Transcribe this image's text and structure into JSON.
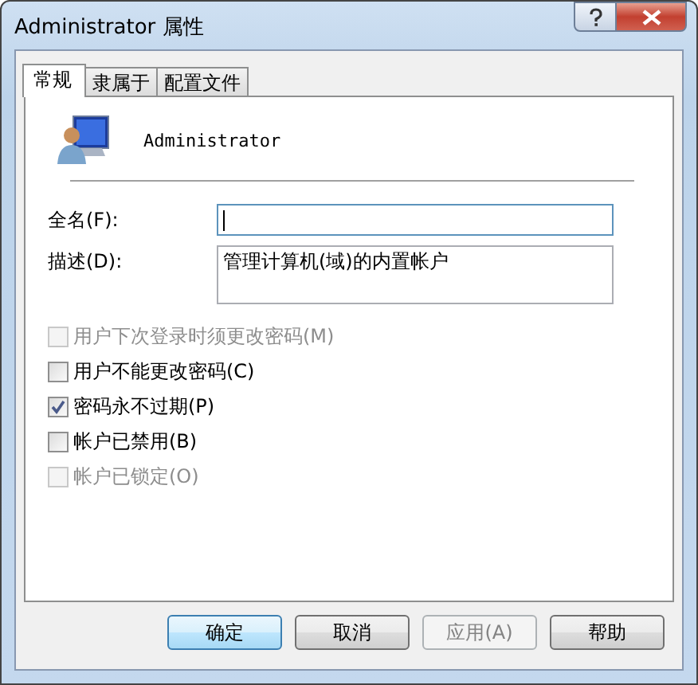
{
  "window": {
    "title": "Administrator 属性"
  },
  "tabs": [
    {
      "label": "常规",
      "selected": true
    },
    {
      "label": "隶属于",
      "selected": false
    },
    {
      "label": "配置文件",
      "selected": false
    }
  ],
  "user": {
    "name": "Administrator"
  },
  "fields": [
    {
      "label": "全名(F):",
      "focused": true
    },
    {
      "label": "描述(D):",
      "value": "管理计算机(域)的内置帐户",
      "focused": false
    }
  ],
  "checkboxes": [
    {
      "label": "用户下次登录时须更改密码(M)",
      "checked": false,
      "disabled": true
    },
    {
      "label": "用户不能更改密码(C)",
      "checked": false,
      "disabled": false
    },
    {
      "label": "密码永不过期(P)",
      "checked": true,
      "disabled": false
    },
    {
      "label": "帐户已禁用(B)",
      "checked": false,
      "disabled": false
    },
    {
      "label": "帐户已锁定(O)",
      "checked": false,
      "disabled": true
    }
  ],
  "buttons": [
    {
      "label": "确定",
      "disabled": false,
      "default": true
    },
    {
      "label": "取消",
      "disabled": false,
      "default": false
    },
    {
      "label": "应用(A)",
      "disabled": true,
      "default": false
    },
    {
      "label": "帮助",
      "disabled": false,
      "default": false
    }
  ]
}
